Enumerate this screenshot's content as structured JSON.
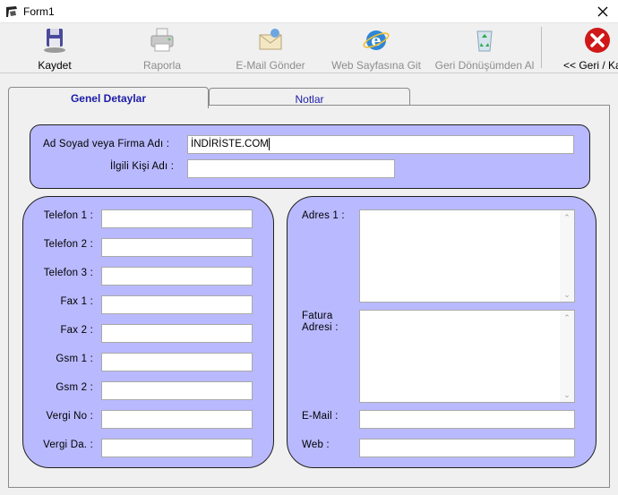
{
  "window": {
    "title": "Form1"
  },
  "toolbar": {
    "save": "Kaydet",
    "report": "Raporla",
    "email": "E-Mail Gönder",
    "web": "Web Sayfasına Git",
    "recycle": "Geri Dönüşümden  Al",
    "back": "<< Geri / Ka"
  },
  "tabs": {
    "general": "Genel Detaylar",
    "notes": "Notlar"
  },
  "top": {
    "name_label": "Ad Soyad veya Firma Adı :",
    "name_value": "İNDİRİSTE.COM",
    "contact_label": "İlgili Kişi Adı :",
    "contact_value": ""
  },
  "left": {
    "phone1": "Telefon 1 :",
    "phone2": "Telefon 2 :",
    "phone3": "Telefon 3 :",
    "fax1": "Fax 1 :",
    "fax2": "Fax 2 :",
    "gsm1": "Gsm 1 :",
    "gsm2": "Gsm 2 :",
    "tax_no": "Vergi No :",
    "tax_office": "Vergi Da. :"
  },
  "right": {
    "address1": "Adres 1 :",
    "billing1": "Fatura",
    "billing2": "Adresi :",
    "email": "E-Mail :",
    "web": "Web :"
  },
  "colors": {
    "group_bg": "#b9b9ff",
    "tab_text": "#1c1ca8",
    "disabled_text": "#8d8d8d",
    "close_red": "#d01818"
  }
}
